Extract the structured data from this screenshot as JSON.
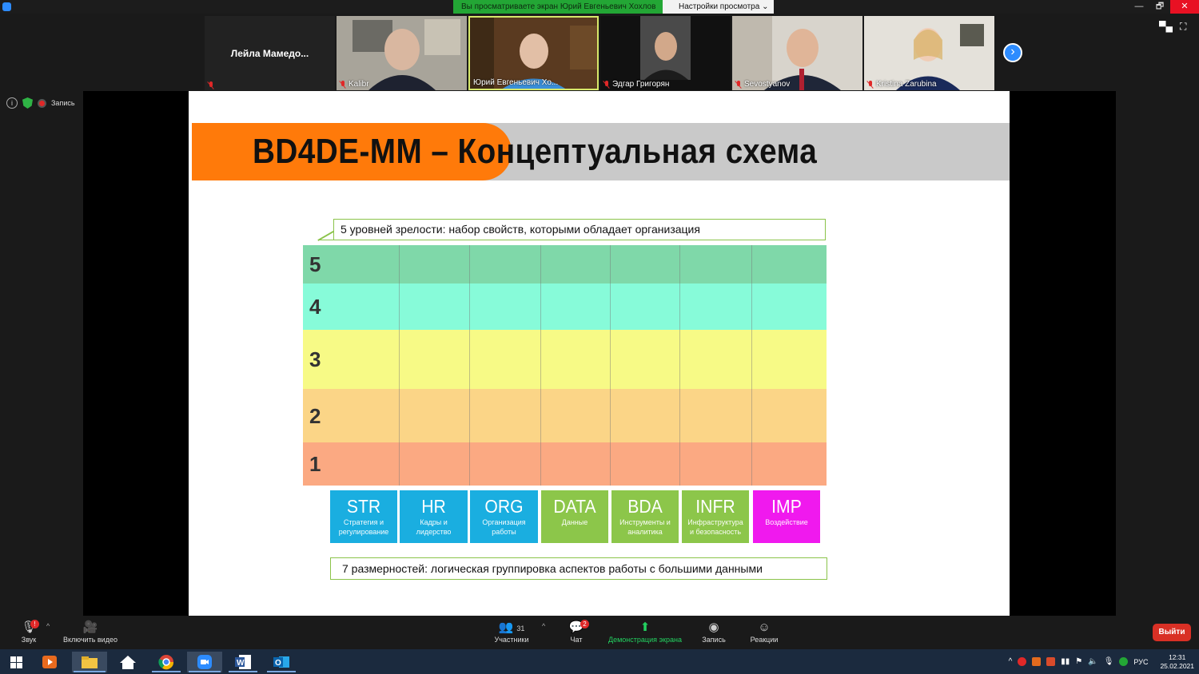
{
  "window": {
    "banner_text": "Вы просматриваете экран Юрий Евгеньевич Хохлов",
    "view_settings": "Настройки просмотра",
    "view_settings_caret": "⌄",
    "minimize": "—",
    "restore": "🗗",
    "close": "✕"
  },
  "participants": [
    {
      "name": "Лейла  Мамедо...",
      "video": false,
      "muted": false
    },
    {
      "name": "Kalibr",
      "video": true,
      "muted": true
    },
    {
      "name": "Юрий Евгеньевич Хо...",
      "video": true,
      "muted": false
    },
    {
      "name": "Эдгар Григорян",
      "video": true,
      "muted": true
    },
    {
      "name": "Sevostyanov",
      "video": true,
      "muted": true
    },
    {
      "name": "Kristina Zarubina",
      "video": true,
      "muted": true
    }
  ],
  "next_arrow": "›",
  "status": {
    "info": "i",
    "recording": "Запись"
  },
  "slide": {
    "title": "BD4DE-MM – Концептуальная схема",
    "levels_callout": "5 уровней зрелости: набор свойств, которыми обладает организация",
    "dims_callout": "7 размерностей: логическая группировка аспектов работы с большими данными",
    "levels": [
      {
        "label": "5",
        "color": "#7fd8a9"
      },
      {
        "label": "4",
        "color": "#87fbd9"
      },
      {
        "label": "3",
        "color": "#f7fa86"
      },
      {
        "label": "2",
        "color": "#fbd587"
      },
      {
        "label": "1",
        "color": "#fba982"
      }
    ],
    "dimensions": [
      {
        "code": "STR",
        "desc": "Стратегия и регулирование",
        "color": "#1aaee0"
      },
      {
        "code": "HR",
        "desc": "Кадры и лидерство",
        "color": "#1aaee0"
      },
      {
        "code": "ORG",
        "desc": "Организация работы",
        "color": "#1aaee0"
      },
      {
        "code": "DATA",
        "desc": "Данные",
        "color": "#8cc64a"
      },
      {
        "code": "BDA",
        "desc": "Инструменты и аналитика",
        "color": "#8cc64a"
      },
      {
        "code": "INFR",
        "desc": "Инфраструктура и безопасность",
        "color": "#8cc64a"
      },
      {
        "code": "IMP",
        "desc": "Воздействие",
        "color": "#f019ee"
      }
    ]
  },
  "toolbar": {
    "audio": "Звук",
    "video": "Включить видео",
    "participants": "Участники",
    "participants_count": "31",
    "chat": "Чат",
    "chat_badge": "2",
    "share": "Демонстрация экрана",
    "record": "Запись",
    "reactions": "Реакции",
    "exit": "Выйти",
    "audio_badge": "!"
  },
  "taskbar": {
    "lang": "РУС",
    "time": "12:31",
    "date": "25.02.2021"
  }
}
